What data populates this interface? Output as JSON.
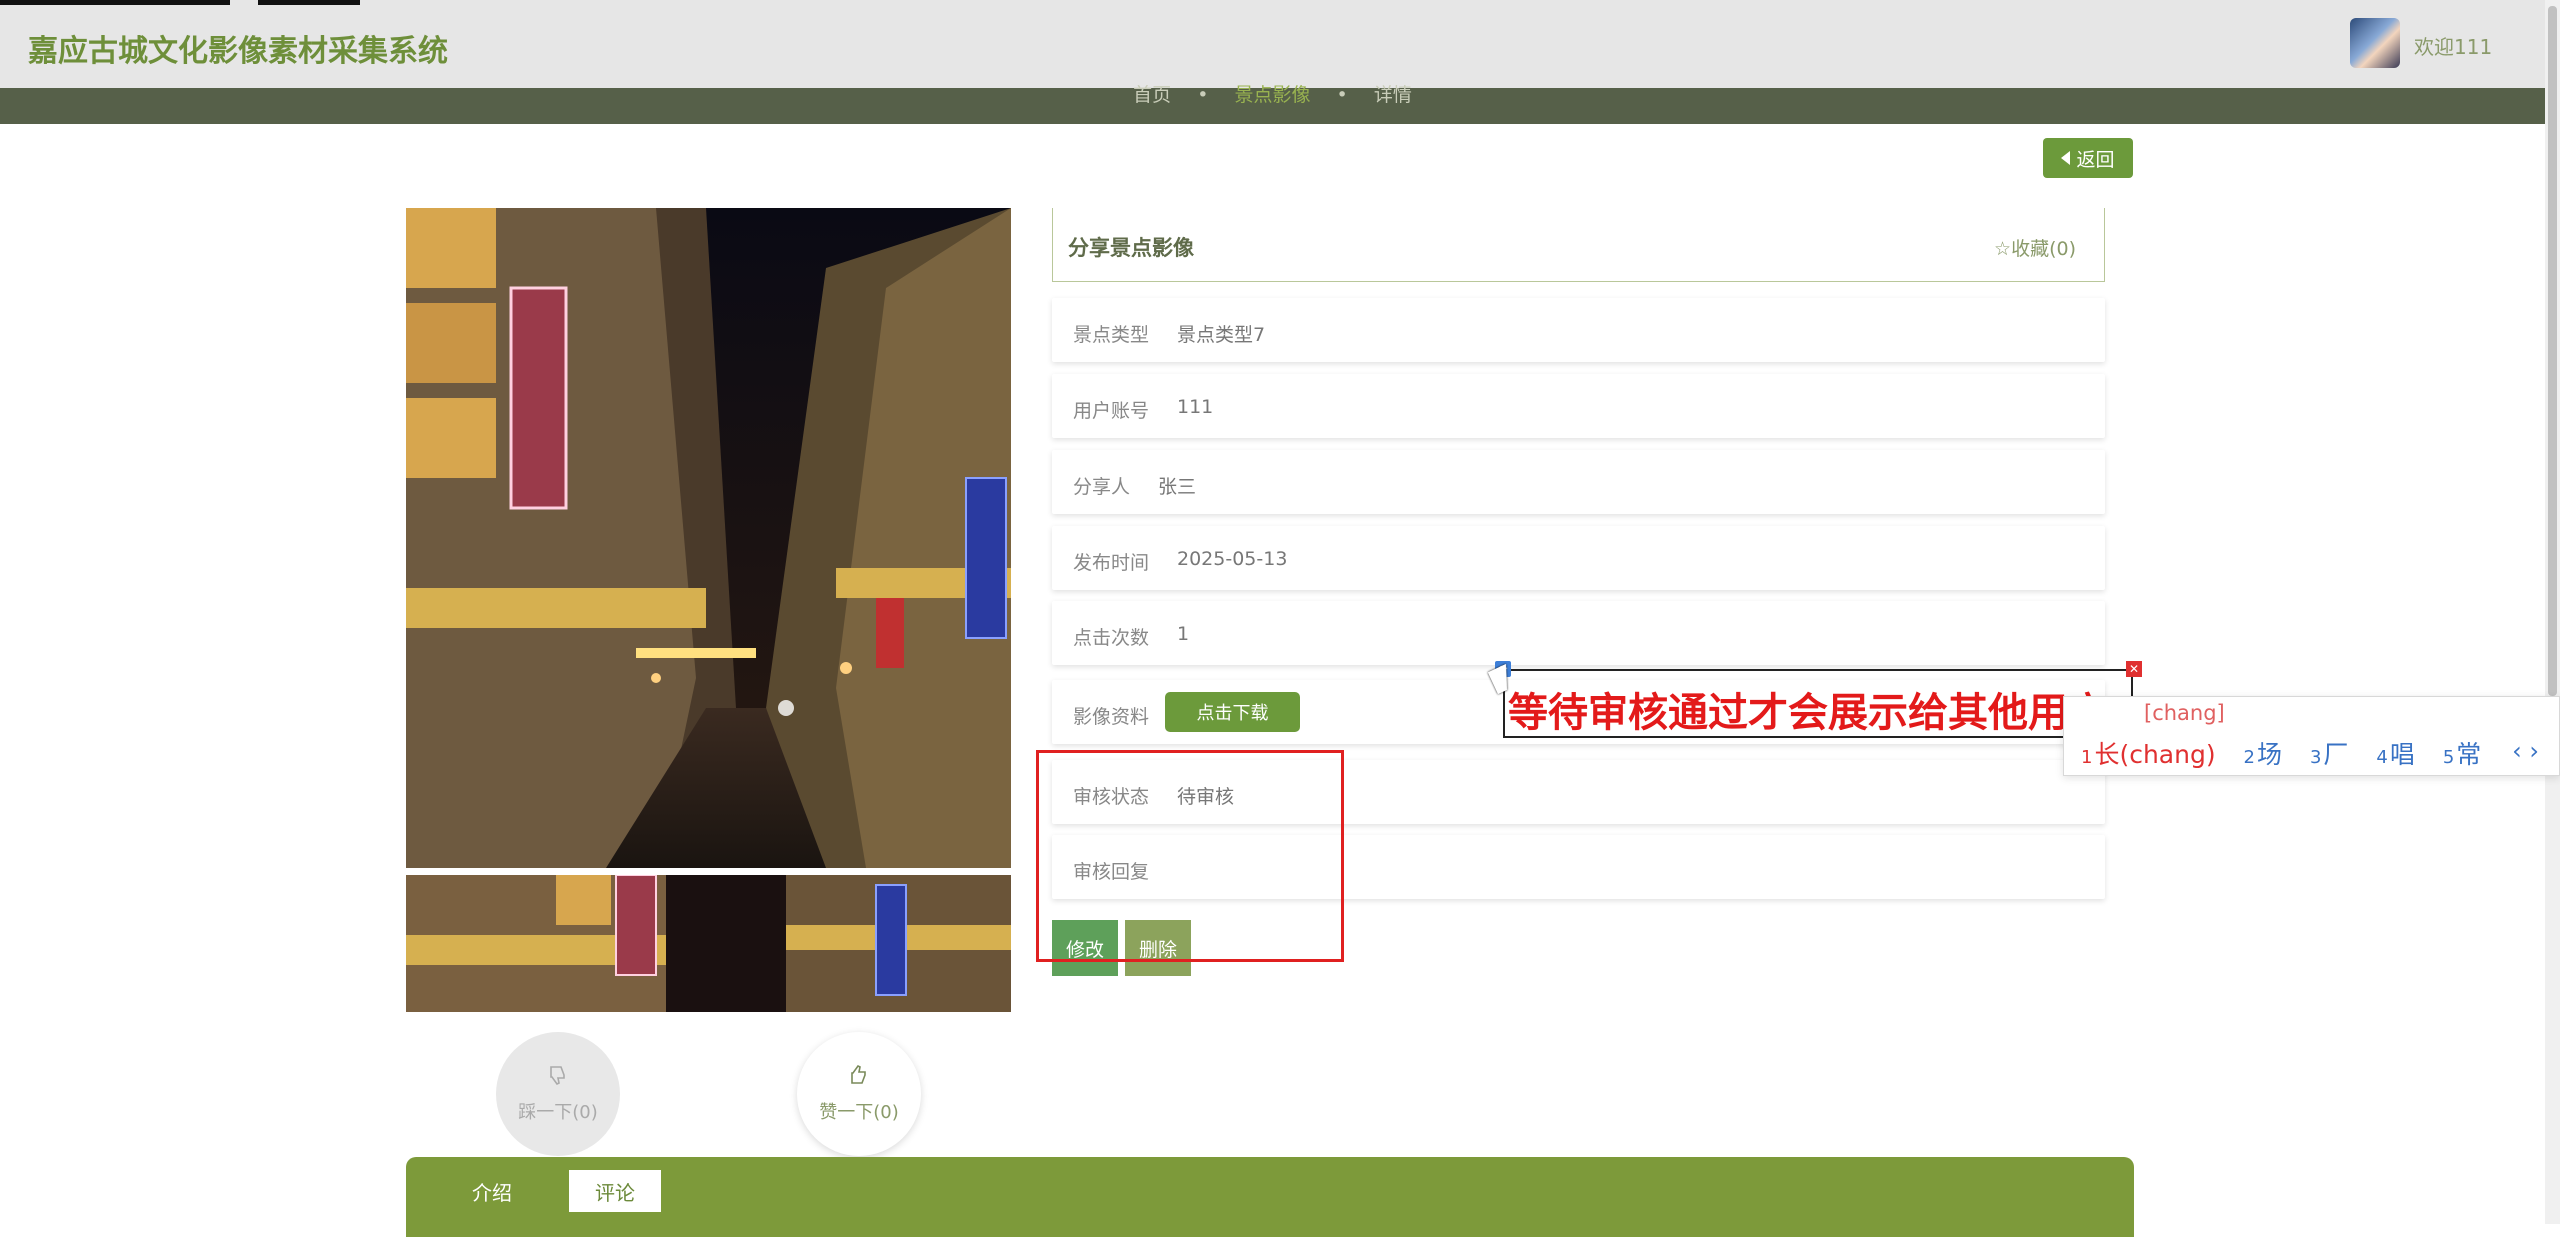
{
  "header": {
    "site_title": "嘉应古城文化影像素材采集系统",
    "welcome": "欢迎111"
  },
  "breadcrumb": {
    "home": "首页",
    "sep": "•",
    "section": "景点影像",
    "current": "详情"
  },
  "back_button": "返回",
  "detail": {
    "card_title": "分享景点影像",
    "favorite": "☆收藏(0)",
    "rows": [
      {
        "label": "景点类型",
        "value": "景点类型7"
      },
      {
        "label": "用户账号",
        "value": "111"
      },
      {
        "label": "分享人",
        "value": "张三"
      },
      {
        "label": "发布时间",
        "value": "2025-05-13"
      },
      {
        "label": "点击次数",
        "value": "1"
      },
      {
        "label": "影像资料",
        "button": "点击下载"
      },
      {
        "label": "审核状态",
        "value": "待审核"
      },
      {
        "label": "审核回复",
        "value": ""
      }
    ],
    "edit_button": "修改",
    "delete_button": "删除"
  },
  "votes": {
    "down": "踩一下(0)",
    "up": "赞一下(0)"
  },
  "tabs": [
    "介绍",
    "评论"
  ],
  "annotation": {
    "text": "等待审核通过才会展示给其他用户"
  },
  "ime": {
    "pinyin": "[chang]",
    "candidates": [
      {
        "n": "1",
        "c": "长(chang)"
      },
      {
        "n": "2",
        "c": "场"
      },
      {
        "n": "3",
        "c": "厂"
      },
      {
        "n": "4",
        "c": "唱"
      },
      {
        "n": "5",
        "c": "常"
      }
    ],
    "arrows": "‹ ›"
  },
  "colors": {
    "accent": "#6c9a3b",
    "nav": "#566049",
    "annotation": "#e31a1a"
  }
}
